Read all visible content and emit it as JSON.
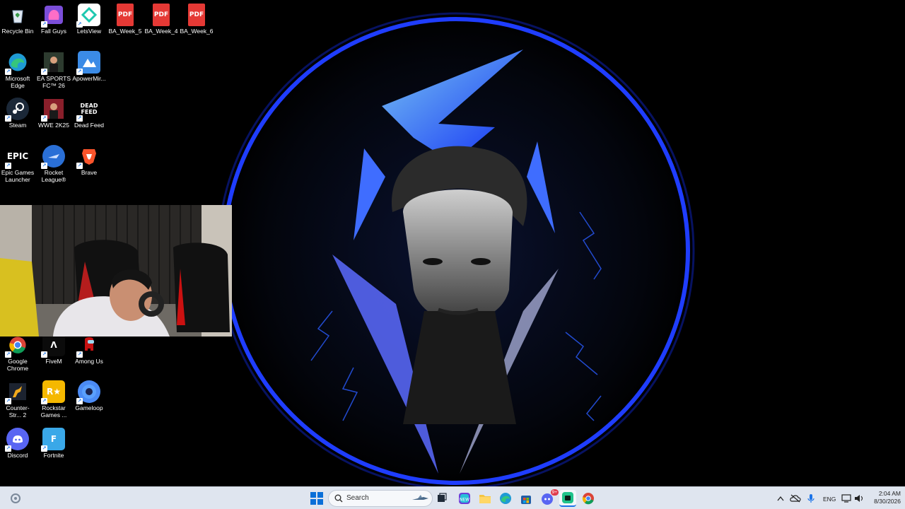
{
  "desktop": {
    "icons": [
      {
        "label": "Recycle Bin",
        "icon": "recycle-bin-icon",
        "color": "#cfe2f3"
      },
      {
        "label": "Fall Guys",
        "icon": "fall-guys-icon",
        "color": "#9b59d0"
      },
      {
        "label": "LetsView",
        "icon": "letsview-icon",
        "color": "#ffffff"
      },
      {
        "label": "BA_Week_5",
        "icon": "pdf-icon",
        "color": "#e53935"
      },
      {
        "label": "BA_Week_4",
        "icon": "pdf-icon",
        "color": "#e53935"
      },
      {
        "label": "BA_Week_6",
        "icon": "pdf-icon",
        "color": "#e53935"
      },
      {
        "label": "Microsoft Edge",
        "icon": "edge-icon",
        "color": "#1fa0a0"
      },
      {
        "label": "EA SPORTS FC™ 26",
        "icon": "ea-fc-icon",
        "color": "#2d3b2f"
      },
      {
        "label": "ApowerMir...",
        "icon": "apowermirror-icon",
        "color": "#3b8be6"
      },
      {
        "label": "Steam",
        "icon": "steam-icon",
        "color": "#1b2838"
      },
      {
        "label": "WWE 2K25",
        "icon": "wwe-icon",
        "color": "#8a1f2b"
      },
      {
        "label": "Dead Feed",
        "icon": "dead-feed-icon",
        "color": "#111111"
      },
      {
        "label": "Epic Games Launcher",
        "icon": "epic-games-icon",
        "color": "#000000"
      },
      {
        "label": "Rocket League®",
        "icon": "rocket-league-icon",
        "color": "#2a6fd6"
      },
      {
        "label": "Brave",
        "icon": "brave-icon",
        "color": "#e8571f"
      },
      {
        "label": "Google Chrome",
        "icon": "chrome-icon",
        "color": "#4285f4"
      },
      {
        "label": "FiveM",
        "icon": "fivem-icon",
        "color": "#0b0b0b"
      },
      {
        "label": "Among Us",
        "icon": "among-us-icon",
        "color": "#c51111"
      },
      {
        "label": "Counter-Str... 2",
        "icon": "counter-strike-icon",
        "color": "#e6a019"
      },
      {
        "label": "Rockstar Games ...",
        "icon": "rockstar-icon",
        "color": "#f5b800"
      },
      {
        "label": "Gameloop",
        "icon": "gameloop-icon",
        "color": "#4b8bf5"
      },
      {
        "label": "Discord",
        "icon": "discord-icon",
        "color": "#5865f2"
      },
      {
        "label": "Fortnite",
        "icon": "fortnite-icon",
        "color": "#3aa8e8"
      }
    ],
    "icon_glyphs": {
      "pdf": "PDF",
      "epic": "EPIC",
      "dead_feed": "DEAD FEED",
      "rockstar": "R★",
      "fortnite": "F",
      "fivem": "Λ"
    }
  },
  "taskbar": {
    "search_placeholder": "Search",
    "pinned": [
      "start-icon",
      "search-icon",
      "task-view-icon",
      "copilot-icon",
      "file-explorer-icon",
      "edge-icon",
      "microsoft-store-icon",
      "discord-icon",
      "app-icon",
      "chrome-icon"
    ],
    "discord_badge": "9+",
    "tray": {
      "language": "ENG",
      "time": "2:04 AM",
      "date": "8/30/2026"
    }
  },
  "colors": {
    "accent_blue": "#1f5dff",
    "taskbar_bg": "#dfe5ef"
  }
}
